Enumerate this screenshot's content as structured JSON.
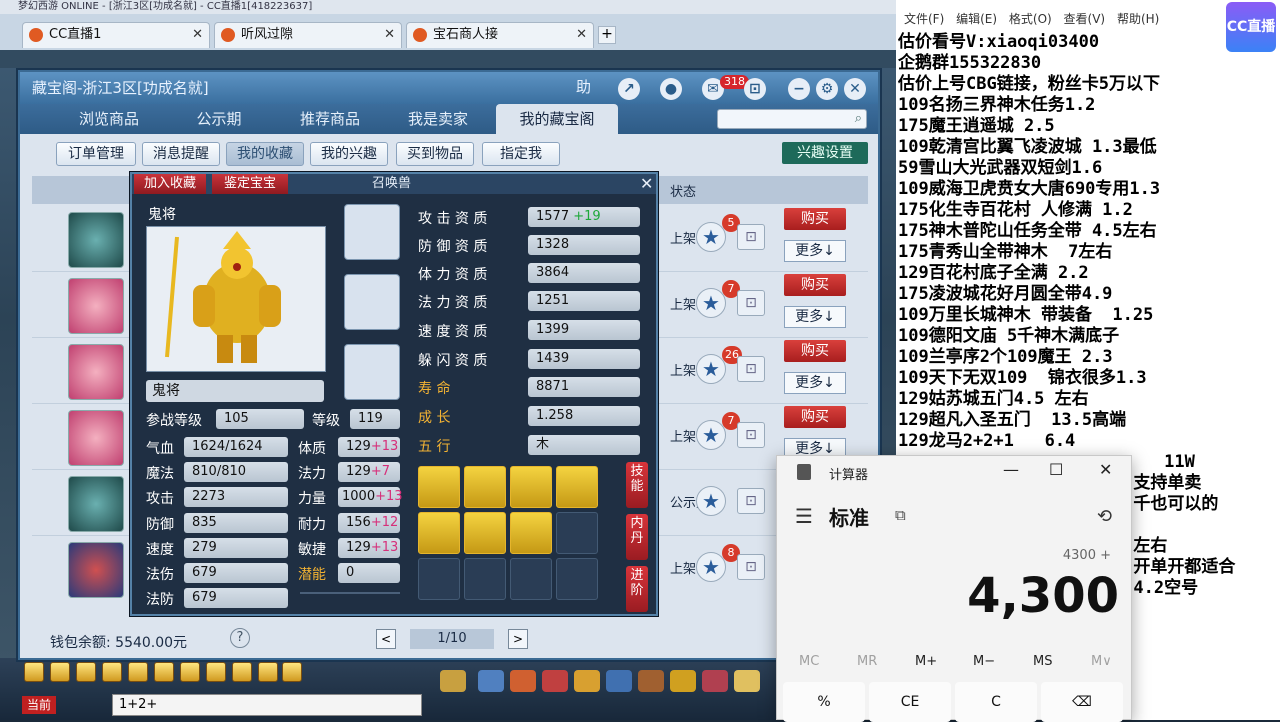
{
  "browser": {
    "titlebar": "梦幻西游 ONLINE - [浙江3区[功成名就] - CC直播1[418223637]",
    "tabs": [
      {
        "label": "CC直播1"
      },
      {
        "label": "听风过隙"
      },
      {
        "label": "宝石商人接"
      }
    ],
    "new_tab": "+"
  },
  "window": {
    "title": "藏宝阁-浙江3区[功成名就]",
    "help": "助",
    "message_count": "318",
    "nav_tabs": [
      "浏览商品",
      "公示期",
      "推荐商品",
      "我是卖家",
      "我的藏宝阁"
    ],
    "active_nav": "我的藏宝阁",
    "subtabs": [
      "订单管理",
      "消息提醒",
      "我的收藏",
      "我的兴趣",
      "买到物品",
      "指定我"
    ],
    "active_sub": "我的收藏",
    "interest_settings": "兴趣设置",
    "list_status_header": "状态",
    "rows": [
      {
        "state": "上架",
        "fav_count": "5",
        "buy": "购买",
        "more": "更多↓"
      },
      {
        "state": "上架",
        "fav_count": "7",
        "buy": "购买",
        "more": "更多↓"
      },
      {
        "state": "上架",
        "fav_count": "26",
        "buy": "购买",
        "more": "更多↓"
      },
      {
        "state": "上架",
        "fav_count": "7",
        "buy": "购买",
        "more": "更多↓"
      },
      {
        "state": "公示期",
        "fav_count": "",
        "buy": "",
        "more": ""
      },
      {
        "state": "上架",
        "fav_count": "8",
        "buy": "",
        "more": ""
      }
    ],
    "wallet": "钱包余额: 5540.00元",
    "help_icon": "?",
    "page_prev": "<",
    "page_next": ">",
    "page": "1/10"
  },
  "pet": {
    "tab_add_fav": "加入收藏",
    "tab_appraise": "鉴定宝宝",
    "title": "召唤兽",
    "name": "鬼将",
    "name_input": "鬼将",
    "aptitudes": [
      {
        "label": "攻 击 资 质",
        "value": "1577",
        "plus": "+19"
      },
      {
        "label": "防 御 资 质",
        "value": "1328",
        "plus": ""
      },
      {
        "label": "体 力 资 质",
        "value": "3864",
        "plus": ""
      },
      {
        "label": "法 力 资 质",
        "value": "1251",
        "plus": ""
      },
      {
        "label": "速 度 资 质",
        "value": "1399",
        "plus": ""
      },
      {
        "label": "躲 闪 资 质",
        "value": "1439",
        "plus": ""
      }
    ],
    "life_label": "寿        命",
    "life": "8871",
    "growth_label": "成        长",
    "growth": "1.258",
    "element_label": "五        行",
    "element": "木",
    "battle_level_label": "参战等级",
    "battle_level": "105",
    "level_label": "等级",
    "level": "119",
    "stats_left": [
      {
        "label": "气血",
        "value": "1624/1624"
      },
      {
        "label": "魔法",
        "value": "810/810"
      },
      {
        "label": "攻击",
        "value": "2273"
      },
      {
        "label": "防御",
        "value": "835"
      },
      {
        "label": "速度",
        "value": "279"
      },
      {
        "label": "法伤",
        "value": "679"
      },
      {
        "label": "法防",
        "value": "679"
      }
    ],
    "stats_right": [
      {
        "label": "体质",
        "value": "129",
        "plus": "+13"
      },
      {
        "label": "法力",
        "value": "129",
        "plus": "+7"
      },
      {
        "label": "力量",
        "value": "1000",
        "plus": "+13"
      },
      {
        "label": "耐力",
        "value": "156",
        "plus": "+12"
      },
      {
        "label": "敏捷",
        "value": "129",
        "plus": "+13"
      },
      {
        "label": "潜能",
        "value": "0",
        "plus": ""
      }
    ],
    "side_tabs": [
      "技能",
      "内丹",
      "进阶"
    ]
  },
  "bottom": {
    "chat_label": "当前",
    "chat_input": "1+2+"
  },
  "notepad": {
    "menu": [
      "文件(F)",
      "编辑(E)",
      "格式(O)",
      "查看(V)",
      "帮助(H)"
    ],
    "lines": [
      "估价看号V:xiaoqi03400",
      "企鹅群155322830",
      "估价上号CBG链接，粉丝卡5万以下",
      "109名扬三界神木任务1.2",
      "175魔王逍遥城 2.5",
      "109乾清宫比翼飞凌波城 1.3最低",
      "59雪山大光武器双短剑1.6",
      "109威海卫虎贲女大唐690专用1.3",
      "175化生寺百花村 人修满 1.2",
      "175神木普陀山任务全带 4.5左右",
      "175青秀山全带神木  7左右",
      "129百花村底子全满 2.2",
      "175凌波城花好月圆全带4.9",
      "109万里长城神木 带装备  1.25",
      "109德阳文庙 5千神木满底子",
      "109兰亭序2个109魔王 2.3",
      "109天下无双109  锦衣很多1.3",
      "129姑苏城五门4.5 左右",
      "129超凡入圣五门  13.5高端",
      "129龙马2+2+1   6.4",
      "                          11W",
      "                       支持单卖",
      "                       千也可以的",
      "",
      "                       左右",
      "                       开单开都适合",
      "                       4.2空号"
    ],
    "cc_logo": "CC直播"
  },
  "calculator": {
    "title": "计算器",
    "mode": "标准",
    "expression": "4300 +",
    "display": "4,300",
    "memory_keys": [
      "MC",
      "MR",
      "M+",
      "M−",
      "MS",
      "M∨"
    ],
    "keys": [
      "%",
      "CE",
      "C",
      "⌫"
    ]
  }
}
